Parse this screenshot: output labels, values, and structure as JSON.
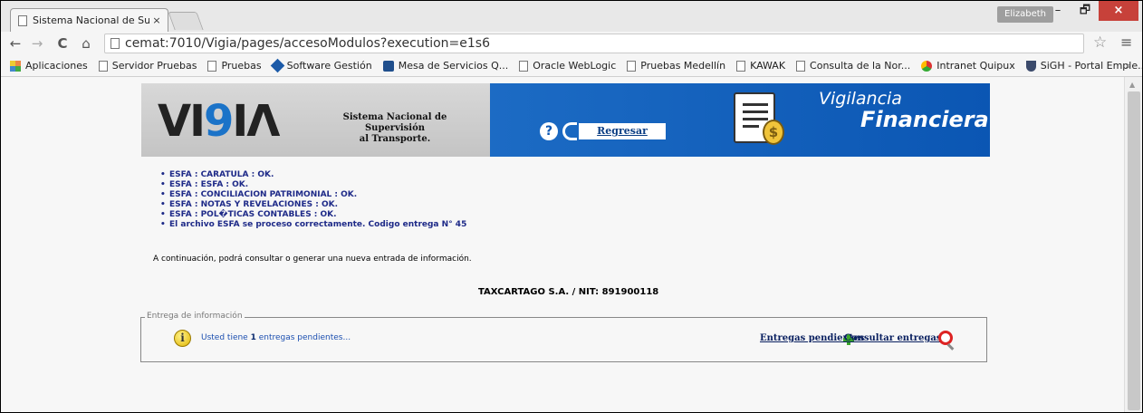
{
  "browser": {
    "tab_title": "Sistema Nacional de Supe",
    "tab_close": "×",
    "user_badge": "Elizabeth",
    "minimize": "–",
    "restore": "🗗",
    "close": "×",
    "url": "cemat:7010/Vigia/pages/accesoModulos?execution=e1s6",
    "back": "←",
    "forward": "→",
    "reload": "C",
    "home": "⌂",
    "star": "☆",
    "menu": "≡",
    "bookmarks_more": "»",
    "bookmarks": [
      {
        "label": "Aplicaciones",
        "icon": "apps-icon"
      },
      {
        "label": "Servidor Pruebas",
        "icon": "page-icon"
      },
      {
        "label": "Pruebas",
        "icon": "page-icon"
      },
      {
        "label": "Software Gestión",
        "icon": "diamond-icon"
      },
      {
        "label": "Mesa de Servicios Q...",
        "icon": "mesa-icon"
      },
      {
        "label": "Oracle WebLogic",
        "icon": "page-icon"
      },
      {
        "label": "Pruebas Medellín",
        "icon": "page-icon"
      },
      {
        "label": "KAWAK",
        "icon": "page-icon"
      },
      {
        "label": "Consulta de la Nor...",
        "icon": "page-icon"
      },
      {
        "label": "Intranet Quipux",
        "icon": "chrome-icon"
      },
      {
        "label": "SiGH - Portal Emple...",
        "icon": "shield-icon"
      }
    ]
  },
  "banner": {
    "logo_v": "VI",
    "logo_g": "9",
    "logo_rest": "IΛ",
    "system_name_1": "Sistema Nacional de Supervisión",
    "system_name_2": "al Transporte.",
    "help": "?",
    "back_label": "Regresar",
    "coin": "$",
    "title_1": "Vigilancia",
    "title_2": "Financiera"
  },
  "messages": [
    "ESFA : CARATULA : OK.",
    "ESFA : ESFA : OK.",
    "ESFA : CONCILIACION PATRIMONIAL : OK.",
    "ESFA : NOTAS Y REVELACIONES : OK.",
    "ESFA : POL�TICAS CONTABLES : OK.",
    "El archivo ESFA se proceso correctamente. Codigo entrega N° 45"
  ],
  "intro": "A continuación, podrá consultar o generar una nueva entrada de información.",
  "company": "TAXCARTAGO S.A. / NIT: 891900118",
  "entrega": {
    "legend": "Entrega de información",
    "info": "i",
    "pending_prefix": "Usted tiene ",
    "pending_count": "1",
    "pending_suffix": " entregas pendientes...",
    "link_pending": "Entregas pendientes",
    "link_consult": "Consultar entregas"
  }
}
